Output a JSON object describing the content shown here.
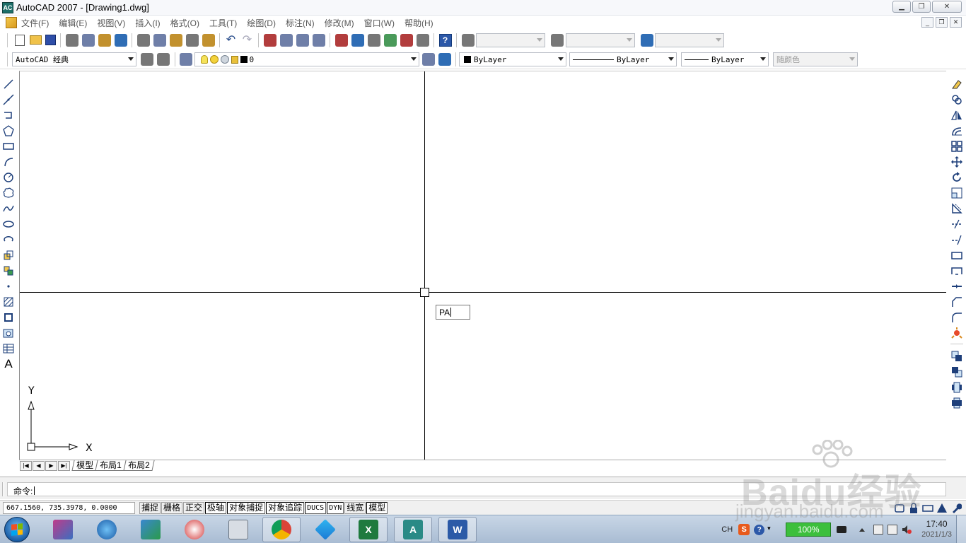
{
  "window": {
    "title": "AutoCAD 2007 - [Drawing1.dwg]",
    "app_icon_label": "AC",
    "controls": [
      "minimize",
      "restore",
      "close"
    ]
  },
  "menubar": {
    "items": [
      {
        "label": "文件(F)"
      },
      {
        "label": "编辑(E)"
      },
      {
        "label": "视图(V)"
      },
      {
        "label": "插入(I)"
      },
      {
        "label": "格式(O)"
      },
      {
        "label": "工具(T)"
      },
      {
        "label": "绘图(D)"
      },
      {
        "label": "标注(N)"
      },
      {
        "label": "修改(M)"
      },
      {
        "label": "窗口(W)"
      },
      {
        "label": "帮助(H)"
      }
    ]
  },
  "standard_toolbar": {
    "help_label": "?",
    "text_style_value": "",
    "dim_style_value": "",
    "table_style_value": ""
  },
  "properties_toolbar": {
    "workspace": "AutoCAD 经典",
    "layer": "0",
    "color": "ByLayer",
    "linetype": "ByLayer",
    "lineweight": "ByLayer",
    "plot_style": "随颜色"
  },
  "draw_toolbar": {
    "text_icon_label": "A"
  },
  "drawing": {
    "dynamic_input": "PA",
    "ucs_x_label": "X",
    "ucs_y_label": "Y"
  },
  "layout_tabs": {
    "tabs": [
      {
        "label": "模型",
        "active": true
      },
      {
        "label": "布局1",
        "active": false
      },
      {
        "label": "布局2",
        "active": false
      }
    ]
  },
  "command_line": {
    "prompt": "命令:"
  },
  "statusbar": {
    "coordinates": "667.1560, 735.3978, 0.0000",
    "buttons": [
      {
        "label": "捕捉",
        "on": false,
        "mono": false
      },
      {
        "label": "栅格",
        "on": false,
        "mono": false
      },
      {
        "label": "正交",
        "on": false,
        "mono": false
      },
      {
        "label": "极轴",
        "on": true,
        "mono": false
      },
      {
        "label": "对象捕捉",
        "on": true,
        "mono": false
      },
      {
        "label": "对象追踪",
        "on": true,
        "mono": false
      },
      {
        "label": "DUCS",
        "on": true,
        "mono": true
      },
      {
        "label": "DYN",
        "on": true,
        "mono": true
      },
      {
        "label": "线宽",
        "on": false,
        "mono": false
      },
      {
        "label": "模型",
        "on": true,
        "mono": false
      }
    ]
  },
  "taskbar": {
    "apps": [
      "start-orb",
      "sketchbook",
      "browser-globe",
      "network-tool",
      "magnifier-tool",
      "calculator",
      "chrome",
      "tencent-app",
      "excel",
      "autocad",
      "word"
    ],
    "ime": "CH",
    "ime_brand": "S",
    "battery": "100%",
    "time": "17:40",
    "date": "2021/1/3"
  },
  "watermark": {
    "brand": "Baidu经验",
    "url": "jingyan.baidu.com"
  },
  "colors": {
    "canvas": "#ffffff",
    "crosshair": "#000000",
    "excel": "#1f7a3e",
    "word": "#2b5aa7",
    "chrome_red": "#db4437",
    "battery": "#3cbf3c"
  }
}
